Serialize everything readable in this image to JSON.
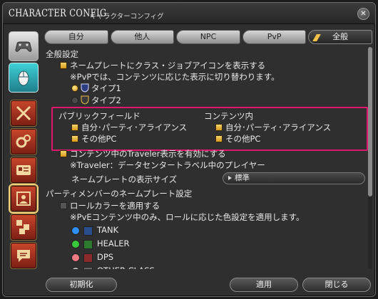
{
  "window": {
    "title": "CHARACTER CONFIG",
    "subtitle": "キャラクターコンフィグ",
    "close_glyph": "✕"
  },
  "sidebar": {
    "items": [
      {
        "icon": "gamepad-icon",
        "state": "normal"
      },
      {
        "icon": "mouse-icon",
        "state": "active"
      },
      {
        "icon": "crossed-swords-icon",
        "state": "normal"
      },
      {
        "icon": "gears-icon",
        "state": "normal"
      },
      {
        "icon": "id-card-icon",
        "state": "normal"
      },
      {
        "icon": "nameplate-icon",
        "state": "selected"
      },
      {
        "icon": "puzzle-icon",
        "state": "normal"
      },
      {
        "icon": "chat-icon",
        "state": "normal"
      }
    ]
  },
  "tabs": [
    {
      "label": "自分",
      "active": false
    },
    {
      "label": "他人",
      "active": false
    },
    {
      "label": "NPC",
      "active": false
    },
    {
      "label": "PvP",
      "active": false
    },
    {
      "label": "全般",
      "active": true
    }
  ],
  "content": {
    "section_general": "全般設定",
    "show_class_icon": {
      "label": "ネームプレートにクラス・ジョブアイコンを表示する",
      "checked": true
    },
    "pvp_note": "※PvPでは、コンテンツに応じた表示に切り替わります。",
    "type1": {
      "label": "タイプ1",
      "selected": true
    },
    "type2": {
      "label": "タイプ2",
      "selected": false
    },
    "public_field": {
      "heading": "パブリックフィールド",
      "self_party": {
        "label": "自分･パーティ･アライアンス",
        "checked": true
      },
      "other_pc": {
        "label": "その他PC",
        "checked": true
      }
    },
    "in_content": {
      "heading": "コンテンツ内",
      "self_party": {
        "label": "自分･パーティ･アライアンス",
        "checked": true
      },
      "other_pc": {
        "label": "その他PC",
        "checked": true
      }
    },
    "traveler": {
      "label": "コンテンツ中のTraveler表示を有効にする",
      "checked": true
    },
    "traveler_note": "※Traveler：データセンタートラベル中のプレイヤー",
    "nameplate_size_label": "ネームプレートの表示サイズ",
    "nameplate_size_value": "標準",
    "party_section": "パーティメンバーのネームプレート設定",
    "role_color": {
      "label": "ロールカラーを適用する",
      "checked": false
    },
    "role_note": "※PvEコンテンツ中のみ、ロールに応じた色設定を適用します。",
    "roles": [
      {
        "label": "TANK",
        "color": "#2f8ff0",
        "icon_color": "#2a4d8c"
      },
      {
        "label": "HEALER",
        "color": "#38c83a",
        "icon_color": "#2d7a2f"
      },
      {
        "label": "DPS",
        "color": "#f07a82",
        "icon_color": "#8a2a2a"
      },
      {
        "label": "OTHER CLASS",
        "color": "#bbbbbb",
        "icon_color": "#666666"
      }
    ]
  },
  "footer": {
    "reset": "初期化",
    "apply": "適用",
    "close": "閉じる"
  },
  "colors": {
    "highlight_box": "#e0176d",
    "checkbox_gold": "#f1c24a"
  }
}
